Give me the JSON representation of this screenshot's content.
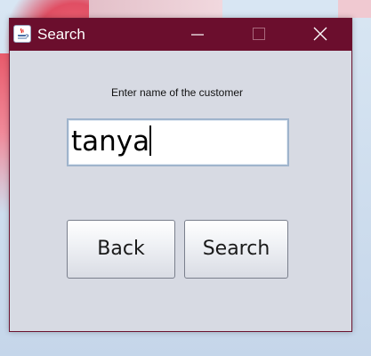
{
  "window": {
    "title": "Search",
    "titlebar_color": "#6b0e2d",
    "background_color": "#d7dae3",
    "app_icon": "java-coffee-icon",
    "controls": [
      "minimize-icon",
      "maximize-icon",
      "close-icon"
    ]
  },
  "form": {
    "prompt": "Enter name of the customer",
    "name_value": "tanya",
    "back_label": "Back",
    "search_label": "Search"
  }
}
